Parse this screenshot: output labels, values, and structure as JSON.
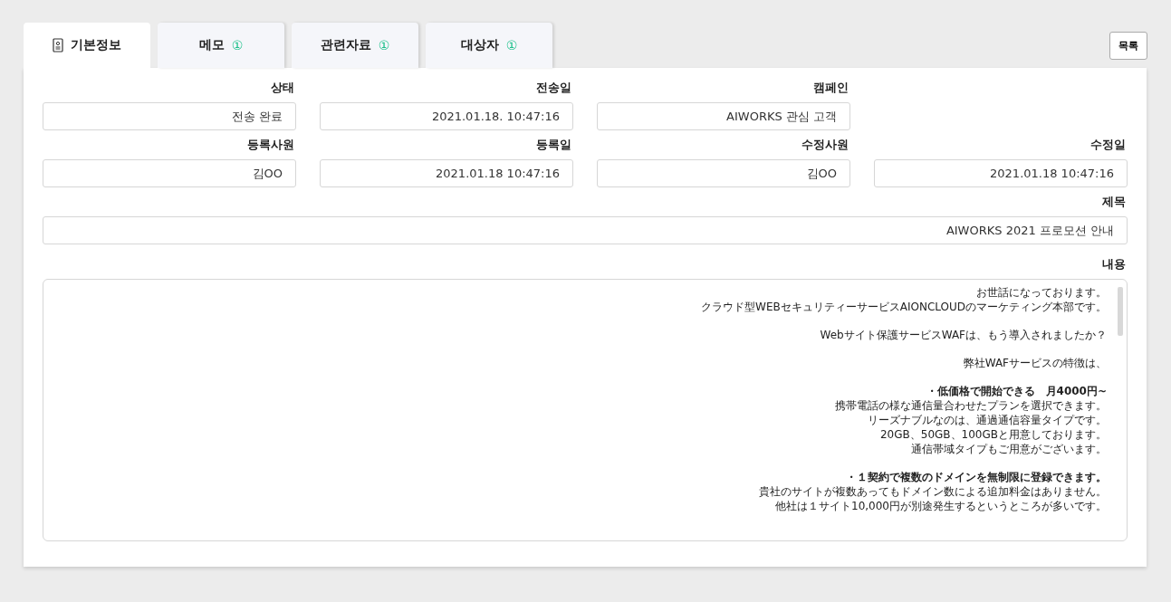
{
  "tabs": [
    {
      "label": "기본정보",
      "selected": true
    },
    {
      "label": "메모",
      "badge": "①",
      "selected": false
    },
    {
      "label": "관련자료",
      "badge": "①",
      "selected": false
    },
    {
      "label": "대상자",
      "badge": "①",
      "selected": false
    }
  ],
  "list_button": "목록",
  "field_rows": [
    [
      {
        "label": "상태",
        "value": "전송 완료"
      },
      {
        "label": "전송일",
        "value": "2021.01.18.  10:47:16"
      },
      {
        "label": "캠페인",
        "value": "AIWORKS 관심 고객"
      }
    ],
    [
      {
        "label": "등록사원",
        "value": "김OO"
      },
      {
        "label": "등록일",
        "value": "2021.01.18  10:47:16"
      },
      {
        "label": "수정사원",
        "value": "김OO"
      },
      {
        "label": "수정일",
        "value": "2021.01.18  10:47:16"
      }
    ]
  ],
  "subject": {
    "label": "제목",
    "value": "AIWORKS 2021 프로모션 안내"
  },
  "content": {
    "label": "내용",
    "paragraphs": [
      {
        "lines": [
          {
            "kind": "text",
            "text": "お世話になっております。"
          },
          {
            "kind": "text",
            "text": "クラウド型WEBセキュリティーサービスAIONCLOUDのマーケティング本部です。"
          }
        ]
      },
      {
        "lines": [
          {
            "kind": "text",
            "text": "Webサイト保護サービスWAFは、もう導入されましたか？"
          }
        ]
      },
      {
        "lines": [
          {
            "kind": "text",
            "text": "弊社WAFサービスの特徴は、"
          }
        ]
      },
      {
        "lines": [
          {
            "kind": "heading",
            "text": "・低価格で開始できる　月4000円~"
          },
          {
            "kind": "text",
            "text": "携帯電話の様な通信量合わせたプランを選択できます。"
          },
          {
            "kind": "text",
            "text": "リーズナブルなのは、通過通信容量タイプです。"
          },
          {
            "kind": "text",
            "text": "20GB、50GB、100GBと用意しております。"
          },
          {
            "kind": "text",
            "text": "通信帯域タイプもご用意がございます。"
          }
        ]
      },
      {
        "lines": [
          {
            "kind": "heading",
            "text": "・１契約で複数のドメインを無制限に登録できます。"
          },
          {
            "kind": "text",
            "text": "貴社のサイトが複数あってもドメイン数による追加料金はありません。"
          },
          {
            "kind": "text",
            "text": "他社は１サイト10,000円が別途発生するというところが多いです。"
          }
        ]
      }
    ]
  }
}
